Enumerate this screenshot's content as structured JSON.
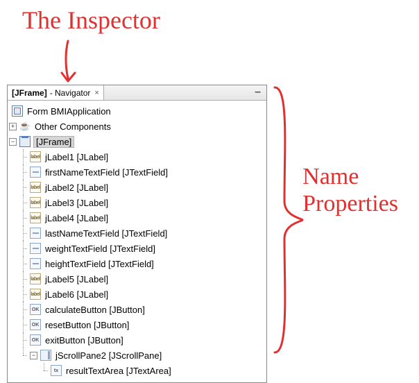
{
  "annotations": {
    "title": "The Inspector",
    "side_line1": "Name",
    "side_line2": "Properties"
  },
  "panel": {
    "tab_title_bold": "[JFrame]",
    "tab_title_rest": " - Navigator",
    "close_x": "×",
    "minimize": "–"
  },
  "tree": {
    "root": "Form BMIApplication",
    "other": "Other Components",
    "jframe": "[JFrame]",
    "children": [
      {
        "label": "jLabel1 [JLabel]",
        "icon": "label"
      },
      {
        "label": "firstNameTextField [JTextField]",
        "icon": "text"
      },
      {
        "label": "jLabel2 [JLabel]",
        "icon": "label"
      },
      {
        "label": "jLabel3 [JLabel]",
        "icon": "label"
      },
      {
        "label": "jLabel4 [JLabel]",
        "icon": "label"
      },
      {
        "label": "lastNameTextField [JTextField]",
        "icon": "text"
      },
      {
        "label": "weightTextField [JTextField]",
        "icon": "text"
      },
      {
        "label": "heightTextField [JTextField]",
        "icon": "text"
      },
      {
        "label": "jLabel5 [JLabel]",
        "icon": "label"
      },
      {
        "label": "jLabel6 [JLabel]",
        "icon": "label"
      },
      {
        "label": "calculateButton [JButton]",
        "icon": "ok"
      },
      {
        "label": "resetButton [JButton]",
        "icon": "ok"
      },
      {
        "label": "exitButton [JButton]",
        "icon": "ok"
      }
    ],
    "scrollpane": "jScrollPane2 [JScrollPane]",
    "textarea": "resultTextArea [JTextArea]",
    "toggle_plus": "+",
    "toggle_minus": "−",
    "icon_label_text": "label",
    "icon_ok_text": "OK",
    "icon_tx_text": "tx"
  }
}
